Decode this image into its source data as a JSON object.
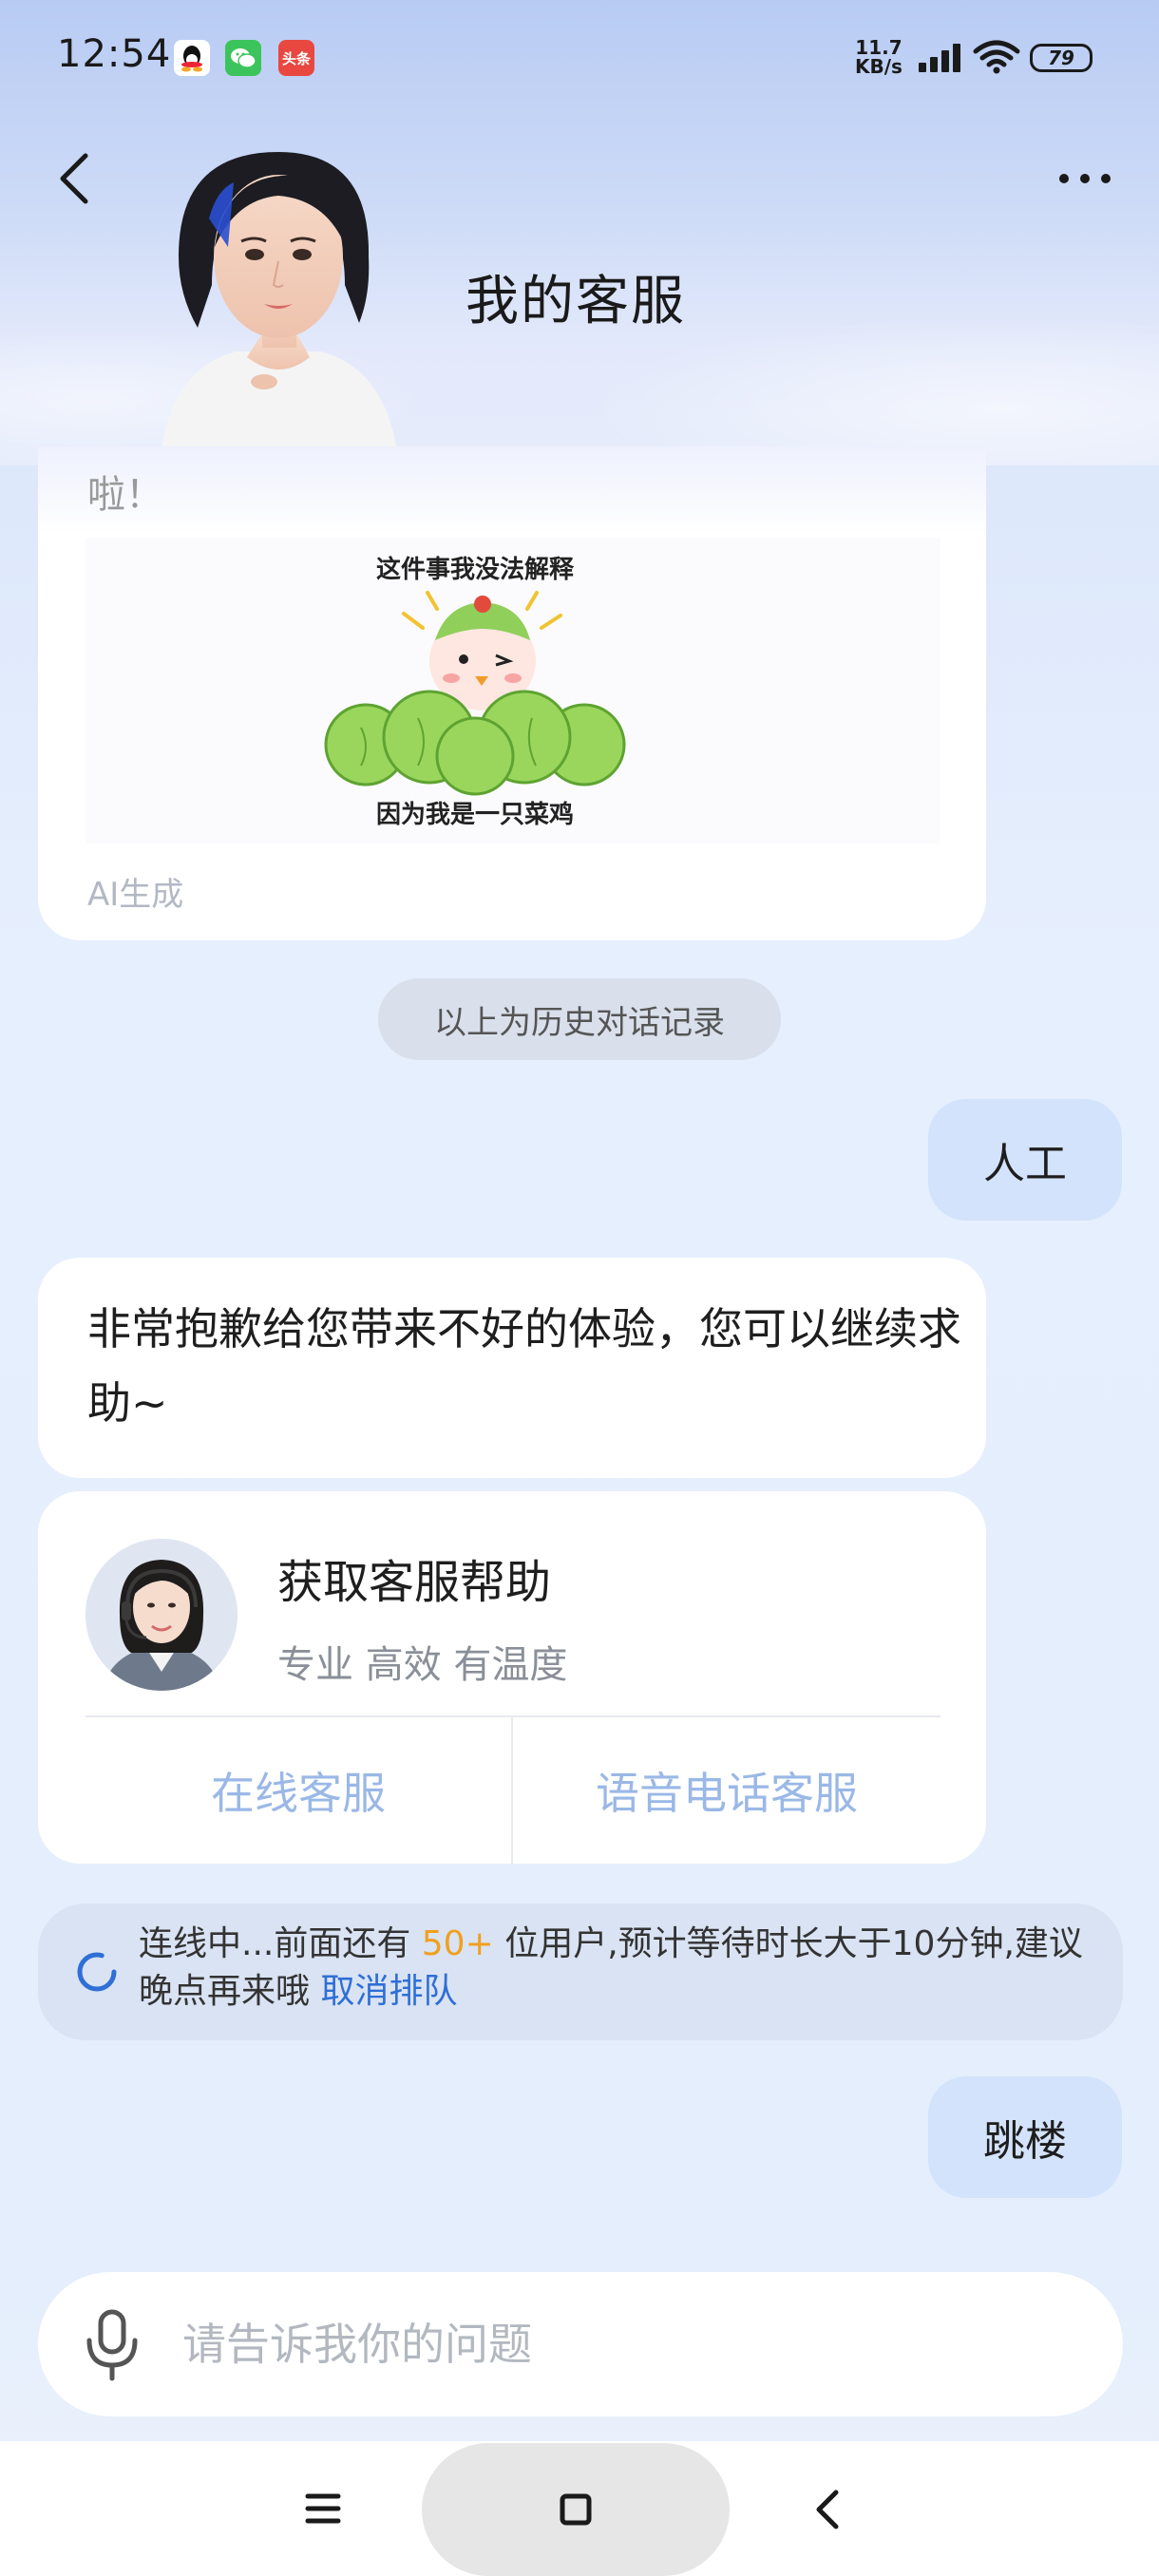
{
  "status_bar": {
    "time": "12:54",
    "net_speed_value": "11.7",
    "net_speed_unit": "KB/s",
    "battery": "79",
    "toutiao_badge": "头条"
  },
  "header": {
    "title": "我的客服"
  },
  "chat": {
    "previous_message_tail": "啦！",
    "meme": {
      "top_text": "这件事我没法解释",
      "bottom_text": "因为我是一只菜鸡"
    },
    "ai_label": "AI生成",
    "history_divider": "以上为历史对话记录",
    "user_message_1": "人工",
    "bot_message": "非常抱歉给您带来不好的体验，您可以继续求助~",
    "service_card": {
      "title": "获取客服帮助",
      "subtitle": "专业 高效 有温度",
      "online_button": "在线客服",
      "phone_button": "语音电话客服"
    },
    "queue": {
      "prefix": "连线中...前面还有 ",
      "count": "50+",
      "suffix": " 位用户,预计等待时长大于10分钟,建议晚点再来哦 ",
      "cancel_link": "取消排队"
    },
    "user_message_2": "跳楼"
  },
  "input": {
    "placeholder": "请告诉我你的问题"
  },
  "colors": {
    "accent_link": "#2f6fd6",
    "queue_count": "#f0a020",
    "user_bubble": "#d3e3fb",
    "service_button_text": "#9ab8e6"
  }
}
